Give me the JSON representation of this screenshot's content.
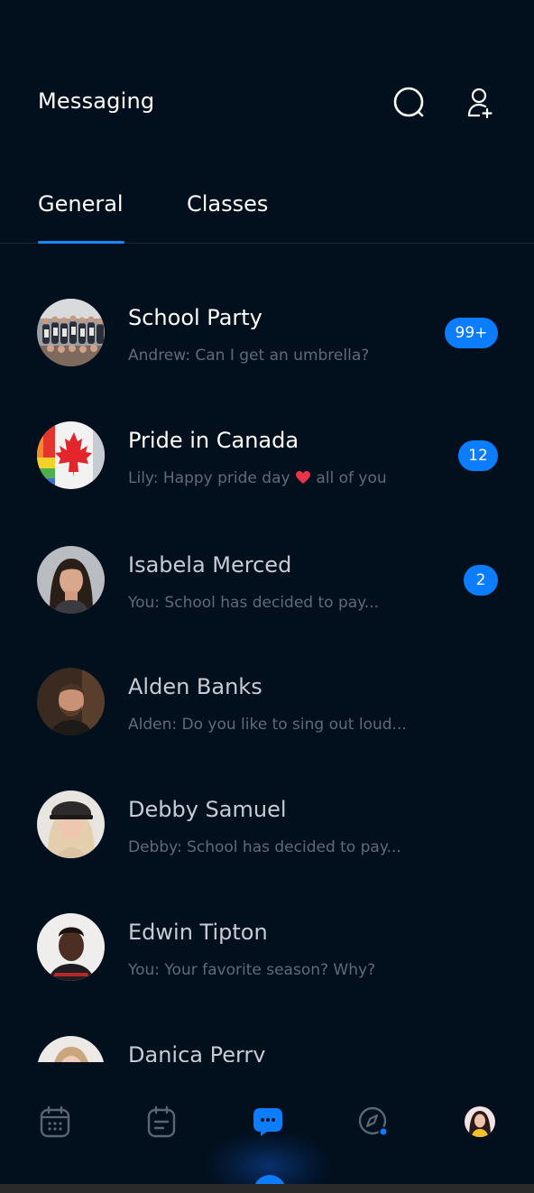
{
  "header": {
    "title": "Messaging",
    "search_icon": "search-icon",
    "add_user_icon": "add-user-icon"
  },
  "tabs": [
    {
      "label": "General",
      "active": true
    },
    {
      "label": "Classes",
      "active": false
    }
  ],
  "conversations": [
    {
      "name": "School Party",
      "preview": "Andrew: Can I get an umbrella?",
      "badge": "99+",
      "avatar": "group-photo-avatar"
    },
    {
      "name": "Pride in Canada",
      "preview_before": "Lily: Happy pride day ",
      "preview_emoji": "heart-emoji",
      "preview_after": " all of you",
      "badge": "12",
      "avatar": "canada-flag-avatar"
    },
    {
      "name": "Isabela Merced",
      "preview": "You: School has decided to pay...",
      "badge": "2",
      "avatar": "person-avatar"
    },
    {
      "name": "Alden Banks",
      "preview": "Alden: Do you like to sing out loud...",
      "badge": null,
      "avatar": "person-avatar"
    },
    {
      "name": "Debby Samuel",
      "preview": "Debby: School has decided to pay...",
      "badge": null,
      "avatar": "person-avatar"
    },
    {
      "name": "Edwin Tipton",
      "preview": "You: Your favorite season? Why?",
      "badge": null,
      "avatar": "person-avatar"
    },
    {
      "name": "Danica Perry",
      "preview": "",
      "badge": null,
      "avatar": "person-avatar"
    }
  ],
  "nav": [
    {
      "icon": "calendar-icon",
      "active": false
    },
    {
      "icon": "notes-icon",
      "active": false
    },
    {
      "icon": "chat-icon",
      "active": true
    },
    {
      "icon": "compass-icon",
      "active": false,
      "dot": true
    },
    {
      "icon": "profile-avatar",
      "active": false
    }
  ],
  "colors": {
    "background": "#020f1d",
    "accent": "#0d7dff",
    "preview_text": "#606b7a",
    "icon_muted": "#5a6675"
  }
}
